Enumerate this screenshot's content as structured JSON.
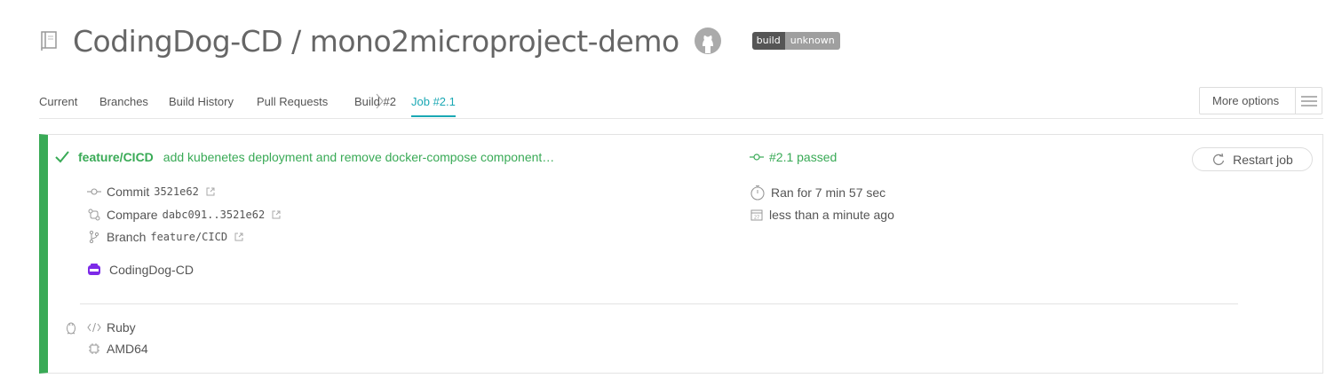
{
  "header": {
    "title": "CodingDog-CD / mono2microproject-demo",
    "badge_left": "build",
    "badge_right": "unknown",
    "repo_icon": "book-icon",
    "github_icon": "github-icon"
  },
  "tabs": {
    "current": "Current",
    "branches": "Branches",
    "build_history": "Build History",
    "pull_requests": "Pull Requests",
    "build": "Build #2",
    "job": "Job #2.1",
    "more_options": "More options"
  },
  "job": {
    "branch": "feature/CICD",
    "commit_message": "add kubenetes deployment and remove docker-compose component…",
    "job_status": "#2.1 passed",
    "restart_label": "Restart job",
    "commit_label": "Commit",
    "commit_sha": "3521e62",
    "compare_label": "Compare",
    "compare_range": "dabc091..3521e62",
    "branch_label": "Branch",
    "branch_name": "feature/CICD",
    "author": "CodingDog-CD",
    "duration": "Ran for 7 min 57 sec",
    "finished": "less than a minute ago",
    "language": "Ruby",
    "arch": "AMD64"
  },
  "colors": {
    "passed": "#39aa56",
    "accent": "#1aa8b4",
    "author_avatar": "#7d2ae8"
  }
}
